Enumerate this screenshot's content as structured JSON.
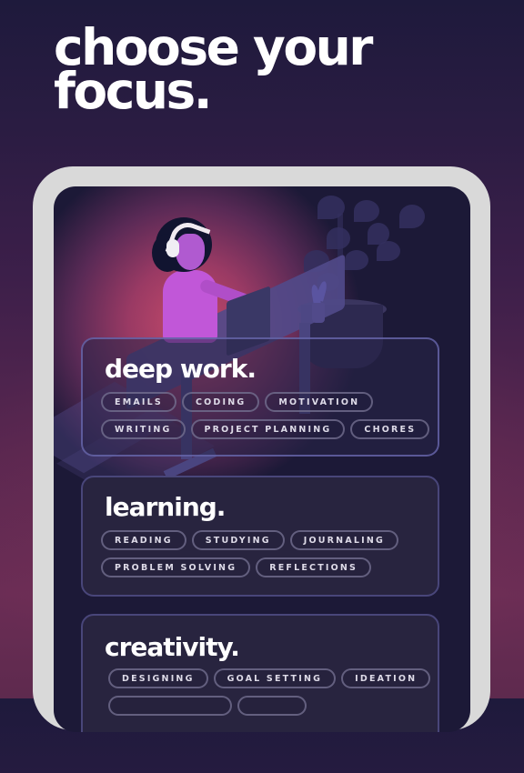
{
  "headline": "choose your\nfocus.",
  "colors": {
    "accent_glow": "#c44a6a",
    "screen_bg": "#1c1937",
    "device_frame": "#d9d9d9",
    "card_border": "#6e6cb4",
    "chip_text": "#dedbe8"
  },
  "illustration": {
    "subject": "person-with-headphones-at-laptop-desk",
    "elements": [
      "person-icon",
      "headphones-icon",
      "laptop-icon",
      "plant-icon",
      "desk-icon"
    ]
  },
  "categories": [
    {
      "title": "deep work.",
      "rows": [
        [
          "EMAILS",
          "CODING",
          "MOTIVATION"
        ],
        [
          "WRITING",
          "PROJECT PLANNING",
          "CHORES"
        ]
      ]
    },
    {
      "title": "learning.",
      "rows": [
        [
          "READING",
          "STUDYING",
          "JOURNALING"
        ],
        [
          "PROBLEM SOLVING",
          "REFLECTIONS"
        ]
      ]
    },
    {
      "title": "creativity.",
      "rows": [
        [
          "DESIGNING",
          "GOAL SETTING",
          "IDEATION"
        ]
      ]
    }
  ]
}
